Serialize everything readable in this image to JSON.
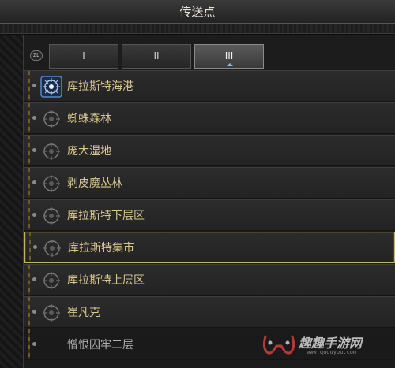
{
  "window": {
    "title": "传送点"
  },
  "map_badge": "ZL",
  "tabs": [
    {
      "label": "I",
      "active": false
    },
    {
      "label": "II",
      "active": false
    },
    {
      "label": "III",
      "active": true
    }
  ],
  "waypoints": [
    {
      "name": "库拉斯特海港",
      "icon": "waypoint-active-icon",
      "status": "active"
    },
    {
      "name": "蜘蛛森林",
      "icon": "waypoint-icon",
      "status": "normal"
    },
    {
      "name": "庞大湿地",
      "icon": "waypoint-icon",
      "status": "normal"
    },
    {
      "name": "剥皮魔丛林",
      "icon": "waypoint-icon",
      "status": "normal"
    },
    {
      "name": "库拉斯特下层区",
      "icon": "waypoint-icon",
      "status": "normal"
    },
    {
      "name": "库拉斯特集市",
      "icon": "waypoint-icon",
      "status": "selected"
    },
    {
      "name": "库拉斯特上层区",
      "icon": "waypoint-icon",
      "status": "normal"
    },
    {
      "name": "崔凡克",
      "icon": "waypoint-icon",
      "status": "normal"
    },
    {
      "name": "憎恨囚牢二层",
      "icon": "waypoint-icon",
      "status": "locked"
    }
  ],
  "watermark": {
    "text": "趣趣手游网",
    "url": "www.ququyou.com"
  },
  "colors": {
    "label_gold": "#d8c690",
    "selection_border": "#c2b06a",
    "active_icon": "#5b86c2"
  }
}
